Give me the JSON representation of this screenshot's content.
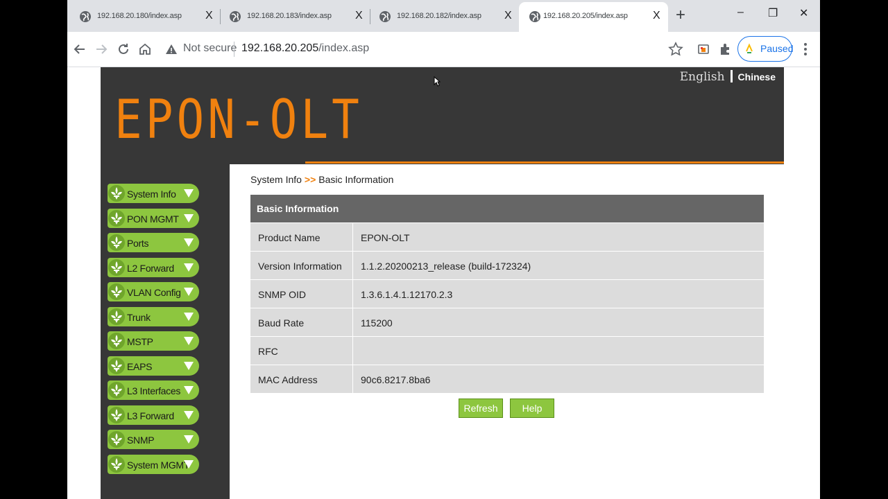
{
  "browser": {
    "tabs": [
      {
        "title": "192.168.20.180/index.asp",
        "close": "X",
        "active": false
      },
      {
        "title": "192.168.20.183/index.asp",
        "close": "X",
        "active": false
      },
      {
        "title": "192.168.20.182/index.asp",
        "close": "X",
        "active": false
      },
      {
        "title": "192.168.20.205/index.asp",
        "close": "X",
        "active": true
      }
    ],
    "new_tab": "+",
    "window_controls": {
      "minimize": "–",
      "restore": "❐",
      "close": "✕"
    },
    "security": "Not secure",
    "url_host": "192.168.20.205",
    "url_path": "/index.asp",
    "profile_status": "Paused",
    "icons": [
      "back-icon",
      "forward-icon",
      "reload-icon",
      "home-icon",
      "warning-icon",
      "star-icon",
      "cast-icon",
      "extensions-icon",
      "more-icon"
    ]
  },
  "header": {
    "brand": "EPON-OLT",
    "lang_english": "English",
    "lang_chinese": "Chinese",
    "accent_color": "#f0810f"
  },
  "sidebar": {
    "items": [
      {
        "label": "System Info"
      },
      {
        "label": "PON MGMT"
      },
      {
        "label": "Ports"
      },
      {
        "label": "L2 Forward"
      },
      {
        "label": "VLAN Config"
      },
      {
        "label": "Trunk"
      },
      {
        "label": "MSTP"
      },
      {
        "label": "EAPS"
      },
      {
        "label": "L3 Interfaces"
      },
      {
        "label": "L3 Forward"
      },
      {
        "label": "SNMP"
      },
      {
        "label": "System MGMT"
      }
    ],
    "item_color": "#8dc63f"
  },
  "content": {
    "breadcrumb_parent": "System Info",
    "breadcrumb_sep": ">>",
    "breadcrumb_current": "Basic Information",
    "table_title": "Basic Information",
    "rows": [
      {
        "key": "Product Name",
        "value": "EPON-OLT"
      },
      {
        "key": "Version Information",
        "value": "1.1.2.20200213_release (build-172324)"
      },
      {
        "key": "SNMP OID",
        "value": "1.3.6.1.4.1.12170.2.3"
      },
      {
        "key": "Baud Rate",
        "value": "115200"
      },
      {
        "key": "RFC",
        "value": ""
      },
      {
        "key": "MAC Address",
        "value": "90c6.8217.8ba6"
      }
    ],
    "refresh_label": "Refresh",
    "help_label": "Help"
  }
}
